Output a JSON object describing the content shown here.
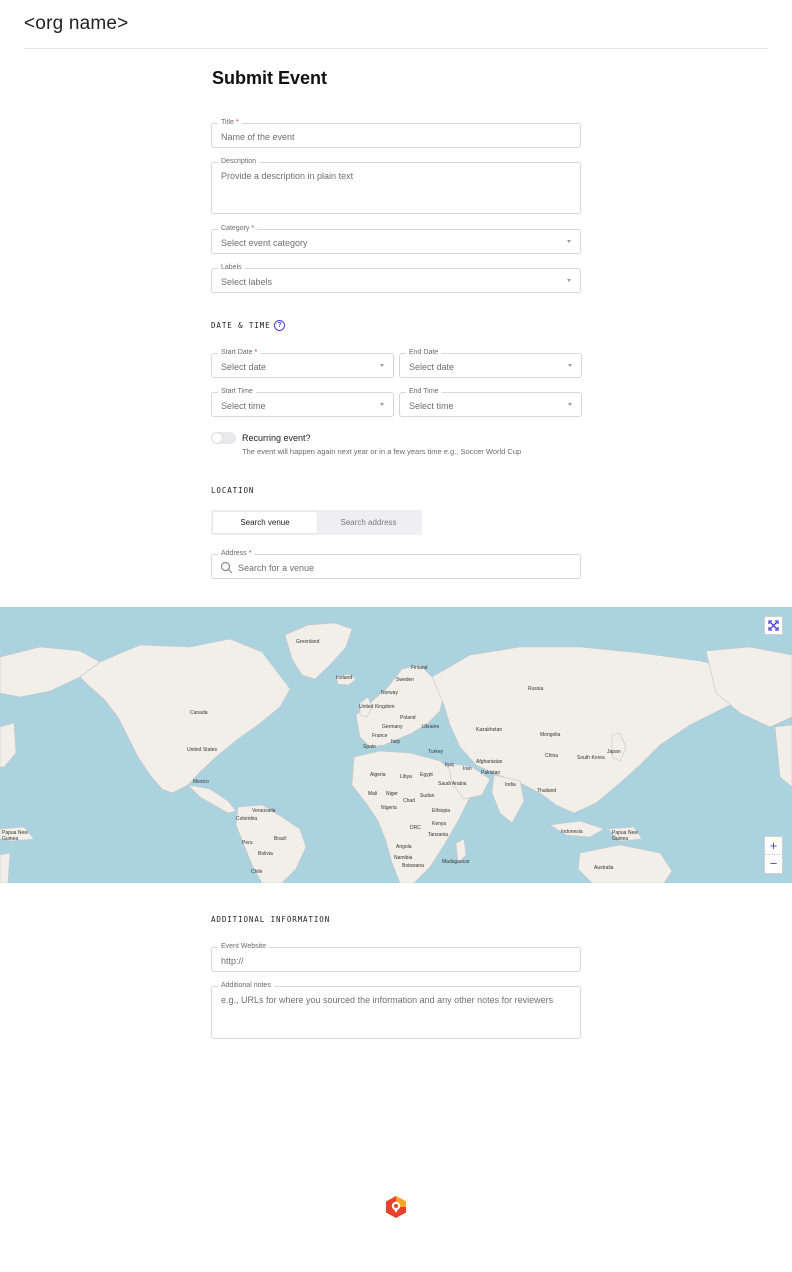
{
  "header": {
    "org_name": "<org name>"
  },
  "page_title": "Submit Event",
  "fields": {
    "title": {
      "label": "Title",
      "required": "*",
      "placeholder": "Name of the event"
    },
    "description": {
      "label": "Description",
      "placeholder": "Provide a description in plain text"
    },
    "category": {
      "label": "Category",
      "required": "*",
      "placeholder": "Select event category"
    },
    "labels": {
      "label": "Labels",
      "placeholder": "Select labels"
    }
  },
  "date_time": {
    "section_title": "DATE & TIME",
    "help_icon_glyph": "?",
    "start_date": {
      "label": "Start Date",
      "required": "*",
      "placeholder": "Select date"
    },
    "end_date": {
      "label": "End Date",
      "placeholder": "Select date"
    },
    "start_time": {
      "label": "Start Time",
      "placeholder": "Select time"
    },
    "end_time": {
      "label": "End Time",
      "placeholder": "Select time"
    },
    "recurring": {
      "label": "Recurring event?",
      "help": "The event will happen again next year or in a few years time e.g., Soccer World Cup",
      "enabled": false
    }
  },
  "location": {
    "section_title": "LOCATION",
    "tabs": [
      {
        "label": "Search venue",
        "active": true
      },
      {
        "label": "Search address",
        "active": false
      }
    ],
    "address": {
      "label": "Address",
      "required": "*",
      "placeholder": "Search for a venue"
    }
  },
  "map": {
    "labels": [
      "Greenland",
      "Iceland",
      "Finland",
      "Sweden",
      "Norway",
      "Russia",
      "United Kingdom",
      "Poland",
      "Ukraine",
      "Kazakhstan",
      "Mongolia",
      "Germany",
      "France",
      "Italy",
      "Spain",
      "Turkey",
      "Canada",
      "United States",
      "Mexico",
      "Iraq",
      "Iran",
      "Afghanistan",
      "Pakistan",
      "China",
      "South Korea",
      "Japan",
      "Algeria",
      "Libya",
      "Egypt",
      "Saudi Arabia",
      "India",
      "Thailand",
      "Mali",
      "Niger",
      "Chad",
      "Sudan",
      "Nigeria",
      "Ethiopia",
      "Venezuela",
      "Colombia",
      "Brazil",
      "Peru",
      "Bolivia",
      "Chile",
      "DRC",
      "Kenya",
      "Tanzania",
      "Angola",
      "Namibia",
      "Botswana",
      "Madagascar",
      "Indonesia",
      "Papua New Guinea",
      "Papua New Guinea",
      "Australia"
    ],
    "zoom_in": "+",
    "zoom_out": "−",
    "colors": {
      "water": "#aad3df",
      "land": "#f2efe9",
      "border": "#c9c2c9"
    }
  },
  "additional": {
    "section_title": "ADDITIONAL INFORMATION",
    "website": {
      "label": "Event Website",
      "value": "http://"
    },
    "notes": {
      "label": "Additional notes",
      "placeholder": "e.g., URLs for where you sourced the information and any other notes for reviewers"
    }
  },
  "colors": {
    "accent": "#4b3fd8",
    "required": "#d9245a",
    "logo_orange": "#f5a623",
    "logo_red": "#e8412c"
  }
}
